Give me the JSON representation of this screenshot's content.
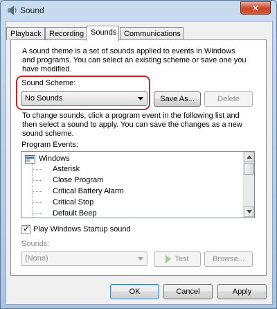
{
  "window": {
    "title": "Sound",
    "close_glyph": "✕"
  },
  "tabs": [
    {
      "label": "Playback"
    },
    {
      "label": "Recording"
    },
    {
      "label": "Sounds"
    },
    {
      "label": "Communications"
    }
  ],
  "description": {
    "line1": "A sound theme is a set of sounds applied to events in Windows",
    "line2": "and programs.  You can select an existing scheme or save one you",
    "line3": "have modified."
  },
  "scheme": {
    "label": "Sound Scheme:",
    "selected": "No Sounds",
    "save_as": "Save As...",
    "delete": "Delete"
  },
  "instructions": {
    "line1": "To change sounds, click a program event in the following list and",
    "line2": "then select a sound to apply.  You can save the changes as a new",
    "line3": "sound scheme."
  },
  "events": {
    "label": "Program Events:",
    "group": "Windows",
    "items": [
      "Asterisk",
      "Close Program",
      "Critical Battery Alarm",
      "Critical Stop",
      "Default Beep"
    ]
  },
  "startup": {
    "label": "Play Windows Startup sound",
    "checked": true
  },
  "sounds": {
    "label": "Sounds:",
    "selected": "(None)",
    "test": "Test",
    "browse": "Browse..."
  },
  "footer": {
    "ok": "OK",
    "cancel": "Cancel",
    "apply": "Apply"
  },
  "colors": {
    "highlight": "#c1272d",
    "close_button": "#c8452a"
  }
}
